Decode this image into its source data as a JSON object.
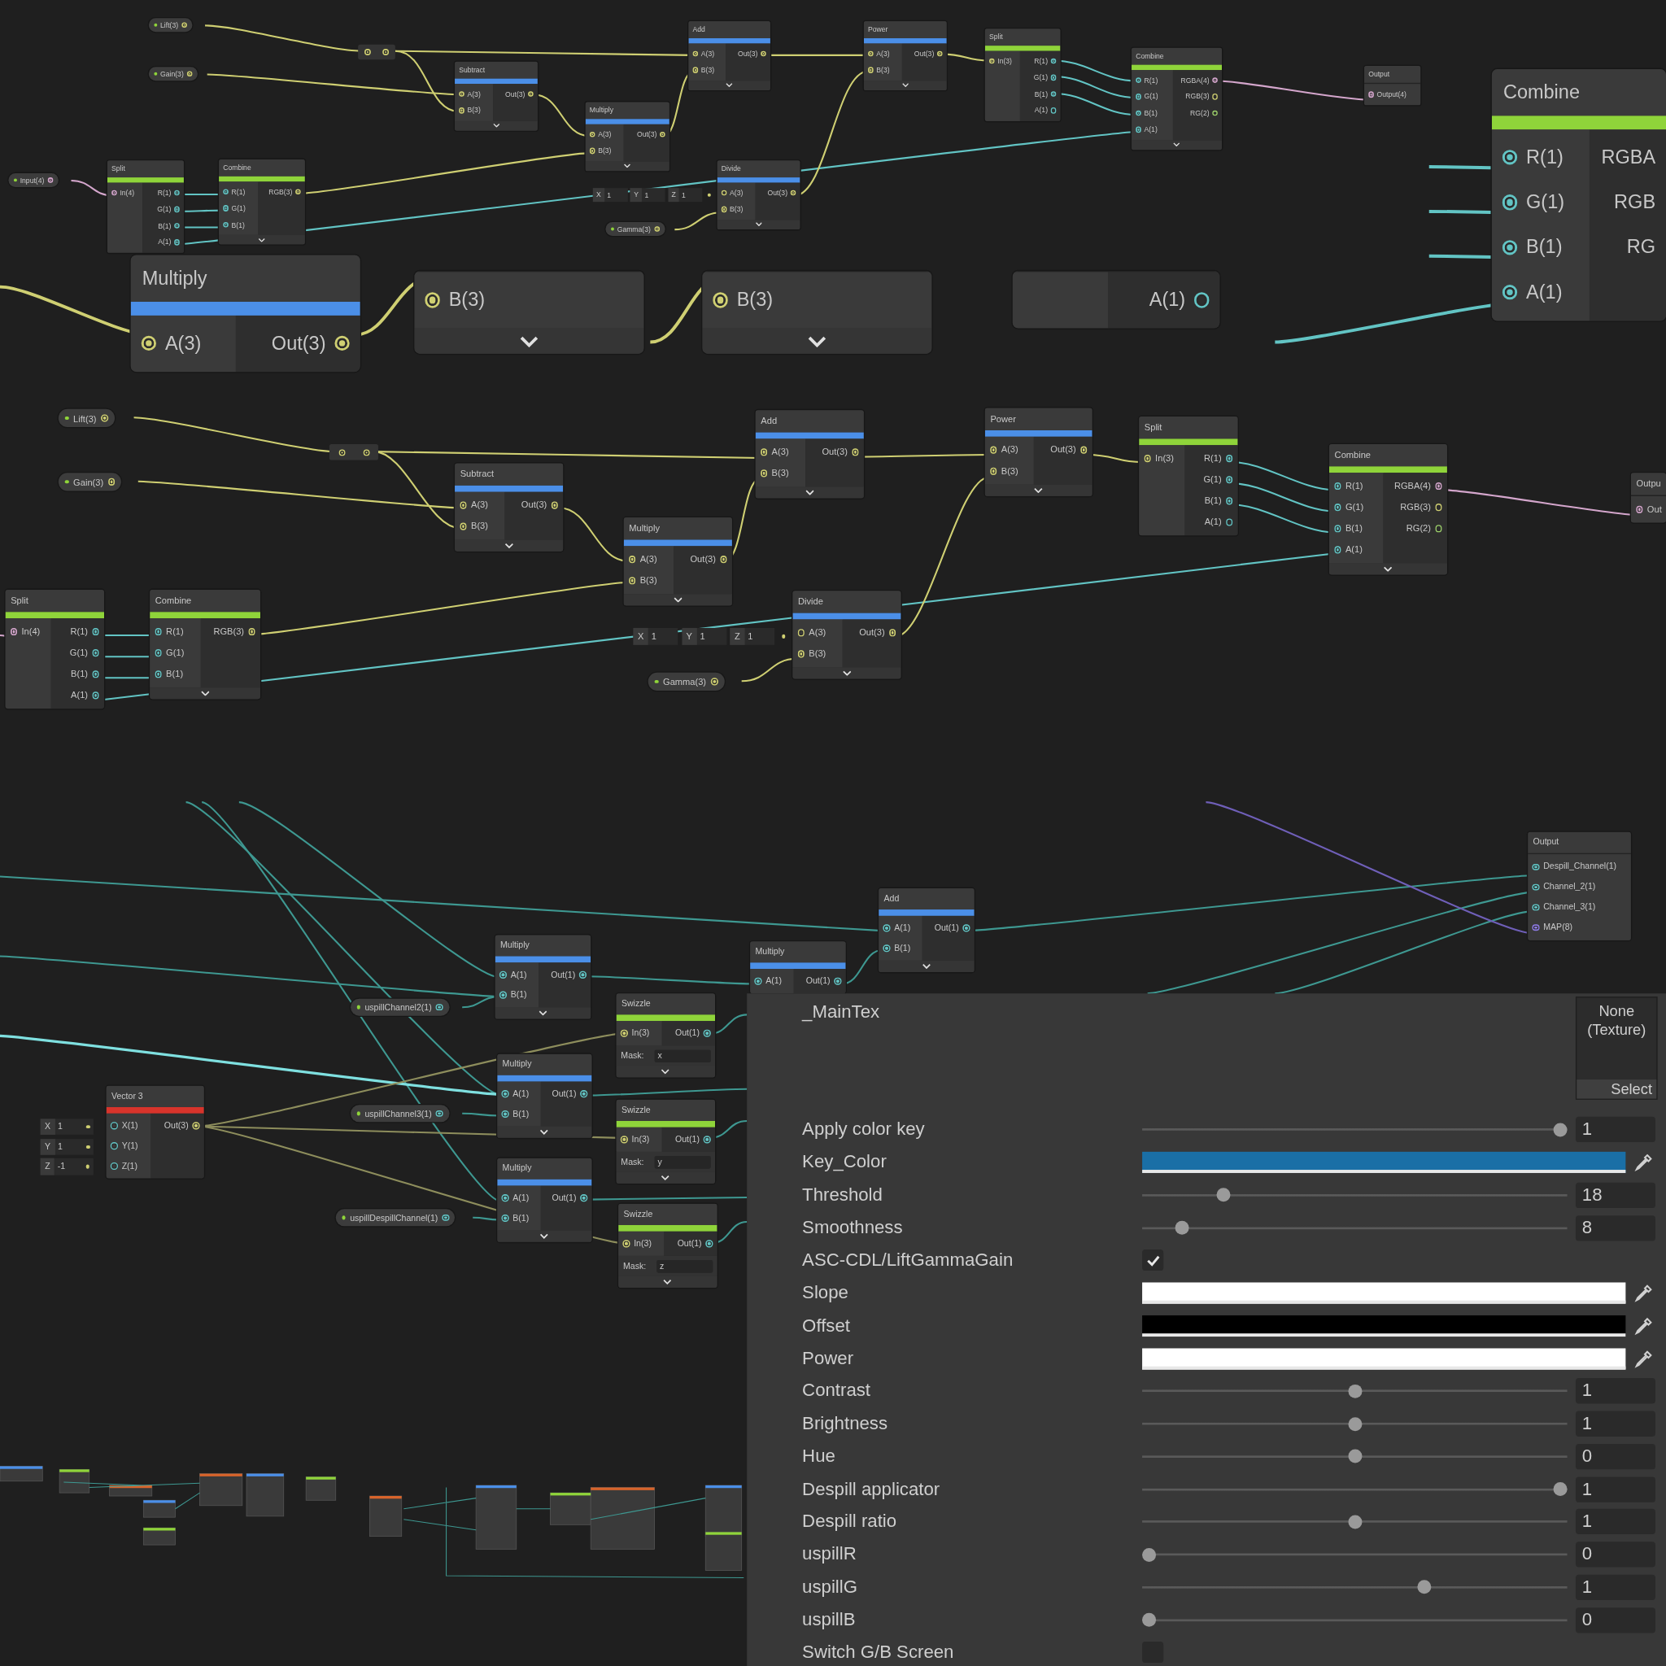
{
  "graph_overview": {
    "nodes": [
      {
        "title": "Subtract",
        "color": "#4b8fe8",
        "expander": true,
        "inputs": [
          {
            "label": "A(3)",
            "color": "#cfcf72",
            "linked": true
          },
          {
            "label": "B(3)",
            "color": "#cfcf72",
            "linked": true
          }
        ],
        "outputs": [
          {
            "label": "Out(3)",
            "color": "#cfcf72",
            "linked": true
          }
        ]
      },
      {
        "title": "Multiply",
        "color": "#4b8fe8",
        "expander": true,
        "inputs": [
          {
            "label": "A(3)",
            "color": "#cfcf72",
            "linked": true
          },
          {
            "label": "B(3)",
            "color": "#cfcf72",
            "linked": true
          }
        ],
        "outputs": [
          {
            "label": "Out(3)",
            "color": "#cfcf72",
            "linked": true
          }
        ]
      },
      {
        "title": "Add",
        "color": "#4b8fe8",
        "expander": true,
        "inputs": [
          {
            "label": "A(3)",
            "color": "#cfcf72",
            "linked": true
          },
          {
            "label": "B(3)",
            "color": "#cfcf72",
            "linked": true
          }
        ],
        "outputs": [
          {
            "label": "Out(3)",
            "color": "#cfcf72",
            "linked": true
          }
        ]
      },
      {
        "title": "Power",
        "color": "#4b8fe8",
        "expander": true,
        "inputs": [
          {
            "label": "A(3)",
            "color": "#cfcf72",
            "linked": true
          },
          {
            "label": "B(3)",
            "color": "#cfcf72",
            "linked": true
          }
        ],
        "outputs": [
          {
            "label": "Out(3)",
            "color": "#cfcf72",
            "linked": true
          }
        ]
      },
      {
        "title": "Split",
        "color": "#8fd43a",
        "expander": false,
        "inputs": [
          {
            "label": "In(3)",
            "color": "#cfcf72",
            "linked": true
          }
        ],
        "outputs": [
          {
            "label": "R(1)",
            "color": "#62c4c4",
            "linked": true
          },
          {
            "label": "G(1)",
            "color": "#62c4c4",
            "linked": true
          },
          {
            "label": "B(1)",
            "color": "#62c4c4",
            "linked": true
          },
          {
            "label": "A(1)",
            "color": "#62c4c4",
            "linked": false
          }
        ]
      },
      {
        "title": "Combine",
        "color": "#8fd43a",
        "expander": true,
        "inputs": [
          {
            "label": "R(1)",
            "color": "#62c4c4",
            "linked": true
          },
          {
            "label": "G(1)",
            "color": "#62c4c4",
            "linked": true
          },
          {
            "label": "B(1)",
            "color": "#62c4c4",
            "linked": true
          },
          {
            "label": "A(1)",
            "color": "#62c4c4",
            "linked": true
          }
        ],
        "outputs": [
          {
            "label": "RGBA(4)",
            "color": "#d4a6cc",
            "linked": true
          },
          {
            "label": "RGB(3)",
            "color": "#cfcf72",
            "linked": false
          },
          {
            "label": "RG(2)",
            "color": "#9ccf6a",
            "linked": false
          }
        ]
      },
      {
        "title": "Output",
        "expander": false,
        "inputs": [
          {
            "label": "Output(4)",
            "color": "#d4a6cc",
            "linked": true
          }
        ]
      },
      {
        "title": "Split",
        "color": "#8fd43a",
        "expander": false,
        "inputs": [
          {
            "label": "In(4)",
            "color": "#d4a6cc",
            "linked": true
          }
        ],
        "outputs": [
          {
            "label": "R(1)",
            "color": "#62c4c4",
            "linked": true
          },
          {
            "label": "G(1)",
            "color": "#62c4c4",
            "linked": true
          },
          {
            "label": "B(1)",
            "color": "#62c4c4",
            "linked": true
          },
          {
            "label": "A(1)",
            "color": "#62c4c4",
            "linked": true
          }
        ]
      },
      {
        "title": "Combine",
        "color": "#8fd43a",
        "expander": true,
        "inputs": [
          {
            "label": "R(1)",
            "color": "#62c4c4",
            "linked": true
          },
          {
            "label": "G(1)",
            "color": "#62c4c4",
            "linked": true
          },
          {
            "label": "B(1)",
            "color": "#62c4c4",
            "linked": true
          }
        ],
        "outputs": [
          {
            "label": "RGB(3)",
            "color": "#cfcf72",
            "linked": true
          }
        ]
      },
      {
        "title": "Divide",
        "color": "#4b8fe8",
        "expander": true,
        "inputs": [
          {
            "label": "A(3)",
            "color": "#cfcf72",
            "linked": false
          },
          {
            "label": "B(3)",
            "color": "#cfcf72",
            "linked": true
          }
        ],
        "outputs": [
          {
            "label": "Out(3)",
            "color": "#cfcf72",
            "linked": true
          }
        ]
      }
    ],
    "properties": [
      {
        "label": "Lift(3)",
        "color": "#cfcf72"
      },
      {
        "label": "Gain(3)",
        "color": "#cfcf72"
      },
      {
        "label": "Input(4)",
        "color": "#d4a6cc"
      },
      {
        "label": "Gamma(3)",
        "color": "#cfcf72"
      }
    ],
    "vector_fields": [
      {
        "axis": "X",
        "value": "1"
      },
      {
        "axis": "Y",
        "value": "1"
      },
      {
        "axis": "Z",
        "value": "1"
      }
    ]
  },
  "zoom_strip": {
    "nodes": [
      {
        "title": "Multiply",
        "color": "#4b8fe8",
        "expander": false,
        "inputs": [
          {
            "label": "A(3)",
            "color": "#cfcf72",
            "linked": true
          }
        ],
        "outputs": [
          {
            "label": "Out(3)",
            "color": "#cfcf72",
            "linked": true
          }
        ]
      },
      {
        "expander": true,
        "inputs": [
          {
            "label": "B(3)",
            "color": "#cfcf72",
            "linked": true
          }
        ]
      },
      {
        "expander": true,
        "inputs": [
          {
            "label": "B(3)",
            "color": "#cfcf72",
            "linked": true
          }
        ]
      },
      {
        "expander": false,
        "outputs": [
          {
            "label": "A(1)",
            "color": "#62c4c4",
            "linked": false
          }
        ]
      }
    ]
  },
  "combine_closeup": {
    "nodes": [
      {
        "title": "Combine",
        "color": "#8fd43a",
        "expander": false,
        "inputs": [
          {
            "label": "R(1)",
            "color": "#62c4c4",
            "linked": true
          },
          {
            "label": "G(1)",
            "color": "#62c4c4",
            "linked": true
          },
          {
            "label": "B(1)",
            "color": "#62c4c4",
            "linked": true
          },
          {
            "label": "A(1)",
            "color": "#62c4c4",
            "linked": true
          }
        ],
        "outputs": [
          {
            "label": "RGBA"
          },
          {
            "label": "RGB"
          },
          {
            "label": "RG"
          }
        ]
      }
    ]
  },
  "graph_main": {
    "nodes": [
      {
        "title": "Subtract",
        "color": "#4b8fe8",
        "expander": true,
        "inputs": [
          {
            "label": "A(3)",
            "color": "#cfcf72",
            "linked": true
          },
          {
            "label": "B(3)",
            "color": "#cfcf72",
            "linked": true
          }
        ],
        "outputs": [
          {
            "label": "Out(3)",
            "color": "#cfcf72",
            "linked": true
          }
        ]
      },
      {
        "title": "Multiply",
        "color": "#4b8fe8",
        "expander": true,
        "inputs": [
          {
            "label": "A(3)",
            "color": "#cfcf72",
            "linked": true
          },
          {
            "label": "B(3)",
            "color": "#cfcf72",
            "linked": true
          }
        ],
        "outputs": [
          {
            "label": "Out(3)",
            "color": "#cfcf72",
            "linked": true
          }
        ]
      },
      {
        "title": "Add",
        "color": "#4b8fe8",
        "expander": true,
        "inputs": [
          {
            "label": "A(3)",
            "color": "#cfcf72",
            "linked": true
          },
          {
            "label": "B(3)",
            "color": "#cfcf72",
            "linked": true
          }
        ],
        "outputs": [
          {
            "label": "Out(3)",
            "color": "#cfcf72",
            "linked": true
          }
        ]
      },
      {
        "title": "Power",
        "color": "#4b8fe8",
        "expander": true,
        "inputs": [
          {
            "label": "A(3)",
            "color": "#cfcf72",
            "linked": true
          },
          {
            "label": "B(3)",
            "color": "#cfcf72",
            "linked": true
          }
        ],
        "outputs": [
          {
            "label": "Out(3)",
            "color": "#cfcf72",
            "linked": true
          }
        ]
      },
      {
        "title": "Split",
        "color": "#8fd43a",
        "expander": false,
        "inputs": [
          {
            "label": "In(3)",
            "color": "#cfcf72",
            "linked": true
          }
        ],
        "outputs": [
          {
            "label": "R(1)",
            "color": "#62c4c4",
            "linked": true
          },
          {
            "label": "G(1)",
            "color": "#62c4c4",
            "linked": true
          },
          {
            "label": "B(1)",
            "color": "#62c4c4",
            "linked": true
          },
          {
            "label": "A(1)",
            "color": "#62c4c4",
            "linked": false
          }
        ]
      },
      {
        "title": "Combine",
        "color": "#8fd43a",
        "expander": true,
        "inputs": [
          {
            "label": "R(1)",
            "color": "#62c4c4",
            "linked": true
          },
          {
            "label": "G(1)",
            "color": "#62c4c4",
            "linked": true
          },
          {
            "label": "B(1)",
            "color": "#62c4c4",
            "linked": true
          },
          {
            "label": "A(1)",
            "color": "#62c4c4",
            "linked": true
          }
        ],
        "outputs": [
          {
            "label": "RGBA(4)",
            "color": "#d4a6cc",
            "linked": true
          },
          {
            "label": "RGB(3)",
            "color": "#cfcf72",
            "linked": false
          },
          {
            "label": "RG(2)",
            "color": "#9ccf6a",
            "linked": false
          }
        ]
      },
      {
        "title": "Outpu",
        "expander": false,
        "inputs": [
          {
            "label": "Out",
            "color": "#d4a6cc",
            "linked": true
          }
        ]
      },
      {
        "title": "Split",
        "color": "#8fd43a",
        "expander": false,
        "inputs": [
          {
            "label": "In(4)",
            "color": "#d4a6cc",
            "linked": true
          }
        ],
        "outputs": [
          {
            "label": "R(1)",
            "color": "#62c4c4",
            "linked": true
          },
          {
            "label": "G(1)",
            "color": "#62c4c4",
            "linked": true
          },
          {
            "label": "B(1)",
            "color": "#62c4c4",
            "linked": true
          },
          {
            "label": "A(1)",
            "color": "#62c4c4",
            "linked": true
          }
        ]
      },
      {
        "title": "Combine",
        "color": "#8fd43a",
        "expander": true,
        "inputs": [
          {
            "label": "R(1)",
            "color": "#62c4c4",
            "linked": true
          },
          {
            "label": "G(1)",
            "color": "#62c4c4",
            "linked": true
          },
          {
            "label": "B(1)",
            "color": "#62c4c4",
            "linked": true
          }
        ],
        "outputs": [
          {
            "label": "RGB(3)",
            "color": "#cfcf72",
            "linked": true
          }
        ]
      },
      {
        "title": "Divide",
        "color": "#4b8fe8",
        "expander": true,
        "inputs": [
          {
            "label": "A(3)",
            "color": "#cfcf72",
            "linked": false
          },
          {
            "label": "B(3)",
            "color": "#cfcf72",
            "linked": true
          }
        ],
        "outputs": [
          {
            "label": "Out(3)",
            "color": "#cfcf72",
            "linked": true
          }
        ]
      }
    ],
    "properties": [
      {
        "label": "Lift(3)",
        "color": "#cfcf72"
      },
      {
        "label": "Gain(3)",
        "color": "#cfcf72"
      },
      {
        "label": "Gamma(3)",
        "color": "#cfcf72"
      }
    ],
    "vector_fields": [
      {
        "axis": "X",
        "value": "1"
      },
      {
        "axis": "Y",
        "value": "1"
      },
      {
        "axis": "Z",
        "value": "1"
      }
    ]
  },
  "graph_despill": {
    "nodes": [
      {
        "title": "Vector 3",
        "color": "#d8342b",
        "expander": false,
        "inputs": [
          {
            "label": "X(1)",
            "color": "#62c4c4",
            "linked": false
          },
          {
            "label": "Y(1)",
            "color": "#62c4c4",
            "linked": false
          },
          {
            "label": "Z(1)",
            "color": "#62c4c4",
            "linked": false
          }
        ],
        "outputs": [
          {
            "label": "Out(3)",
            "color": "#cfcf72",
            "linked": true
          }
        ]
      },
      {
        "title": "Multiply",
        "color": "#4b8fe8",
        "expander": true,
        "inputs": [
          {
            "label": "A(1)",
            "color": "#62c4c4",
            "linked": true
          },
          {
            "label": "B(1)",
            "color": "#62c4c4",
            "linked": true
          }
        ],
        "outputs": [
          {
            "label": "Out(1)",
            "color": "#62c4c4",
            "linked": true
          }
        ]
      },
      {
        "title": "Multiply",
        "color": "#4b8fe8",
        "expander": true,
        "inputs": [
          {
            "label": "A(1)",
            "color": "#62c4c4",
            "linked": true
          },
          {
            "label": "B(1)",
            "color": "#62c4c4",
            "linked": true
          }
        ],
        "outputs": [
          {
            "label": "Out(1)",
            "color": "#62c4c4",
            "linked": true
          }
        ]
      },
      {
        "title": "Multiply",
        "color": "#4b8fe8",
        "expander": true,
        "inputs": [
          {
            "label": "A(1)",
            "color": "#62c4c4",
            "linked": true
          },
          {
            "label": "B(1)",
            "color": "#62c4c4",
            "linked": true
          }
        ],
        "outputs": [
          {
            "label": "Out(1)",
            "color": "#62c4c4",
            "linked": true
          }
        ]
      },
      {
        "title": "Swizzle",
        "color": "#8fd43a",
        "expander": true,
        "inputs": [
          {
            "label": "In(3)",
            "color": "#cfcf72",
            "linked": true
          }
        ],
        "outputs": [
          {
            "label": "Out(1)",
            "color": "#62c4c4",
            "linked": true
          }
        ],
        "mask": {
          "label": "Mask:",
          "value": "x"
        }
      },
      {
        "title": "Swizzle",
        "color": "#8fd43a",
        "expander": true,
        "inputs": [
          {
            "label": "In(3)",
            "color": "#cfcf72",
            "linked": true
          }
        ],
        "outputs": [
          {
            "label": "Out(1)",
            "color": "#62c4c4",
            "linked": true
          }
        ],
        "mask": {
          "label": "Mask:",
          "value": "y"
        }
      },
      {
        "title": "Swizzle",
        "color": "#8fd43a",
        "expander": true,
        "inputs": [
          {
            "label": "In(3)",
            "color": "#cfcf72",
            "linked": true
          }
        ],
        "outputs": [
          {
            "label": "Out(1)",
            "color": "#62c4c4",
            "linked": true
          }
        ],
        "mask": {
          "label": "Mask:",
          "value": "z"
        }
      },
      {
        "title": "Multiply",
        "color": "#4b8fe8",
        "expander": false,
        "inputs": [
          {
            "label": "A(1)",
            "color": "#62c4c4",
            "linked": true
          }
        ],
        "outputs": [
          {
            "label": "Out(1)",
            "color": "#62c4c4",
            "linked": true
          }
        ]
      },
      {
        "title": "Add",
        "color": "#4b8fe8",
        "expander": true,
        "inputs": [
          {
            "label": "A(1)",
            "color": "#62c4c4",
            "linked": true
          },
          {
            "label": "B(1)",
            "color": "#62c4c4",
            "linked": true
          }
        ],
        "outputs": [
          {
            "label": "Out(1)",
            "color": "#62c4c4",
            "linked": true
          }
        ]
      },
      {
        "title": "Output",
        "expander": false,
        "inputs": [
          {
            "label": "Despill_Channel(1)",
            "color": "#62c4c4",
            "linked": true
          },
          {
            "label": "Channel_2(1)",
            "color": "#62c4c4",
            "linked": true
          },
          {
            "label": "Channel_3(1)",
            "color": "#62c4c4",
            "linked": true
          },
          {
            "label": "MAP(8)",
            "color": "#8c7ae0",
            "linked": true
          }
        ]
      }
    ],
    "properties": [
      {
        "label": "uspillChannel2(1)",
        "color": "#62c4c4"
      },
      {
        "label": "uspillChannel3(1)",
        "color": "#62c4c4"
      },
      {
        "label": "uspillDespillChannel(1)",
        "color": "#62c4c4"
      }
    ],
    "vector_fields": [
      {
        "axis": "X",
        "value": "1"
      },
      {
        "axis": "Y",
        "value": "1"
      },
      {
        "axis": "Z",
        "value": "-1"
      }
    ]
  },
  "inspector": {
    "texture": {
      "label": "_MainTex",
      "slot": "None (Texture)",
      "button": "Select"
    },
    "rows": [
      {
        "kind": "slider",
        "label": "Apply color key",
        "level": 1.0,
        "value": "1"
      },
      {
        "kind": "color",
        "label": "Key_Color",
        "color": "#1a6fa6"
      },
      {
        "kind": "slider",
        "label": "Threshold",
        "level": 0.18,
        "value": "18"
      },
      {
        "kind": "slider",
        "label": "Smoothness",
        "level": 0.08,
        "value": "8"
      },
      {
        "kind": "checkbox",
        "label": "ASC-CDL/LiftGammaGain",
        "checked": true
      },
      {
        "kind": "color",
        "label": "Slope",
        "color": "#ffffff"
      },
      {
        "kind": "color",
        "label": "Offset",
        "color": "#000000"
      },
      {
        "kind": "color",
        "label": "Power",
        "color": "#ffffff"
      },
      {
        "kind": "slider",
        "label": "Contrast",
        "level": 0.5,
        "value": "1"
      },
      {
        "kind": "slider",
        "label": "Brightness",
        "level": 0.5,
        "value": "1"
      },
      {
        "kind": "slider",
        "label": "Hue",
        "level": 0.5,
        "value": "0"
      },
      {
        "kind": "slider",
        "label": "Despill applicator",
        "level": 1.0,
        "value": "1"
      },
      {
        "kind": "slider",
        "label": "Despill ratio",
        "level": 0.5,
        "value": "1"
      },
      {
        "kind": "slider",
        "label": "uspillR",
        "level": 0.0,
        "value": "0"
      },
      {
        "kind": "slider",
        "label": "uspillG",
        "level": 0.67,
        "value": "1"
      },
      {
        "kind": "slider",
        "label": "uspillB",
        "level": 0.0,
        "value": "0"
      },
      {
        "kind": "checkbox",
        "label": "Switch G/B Screen",
        "checked": false
      }
    ]
  }
}
